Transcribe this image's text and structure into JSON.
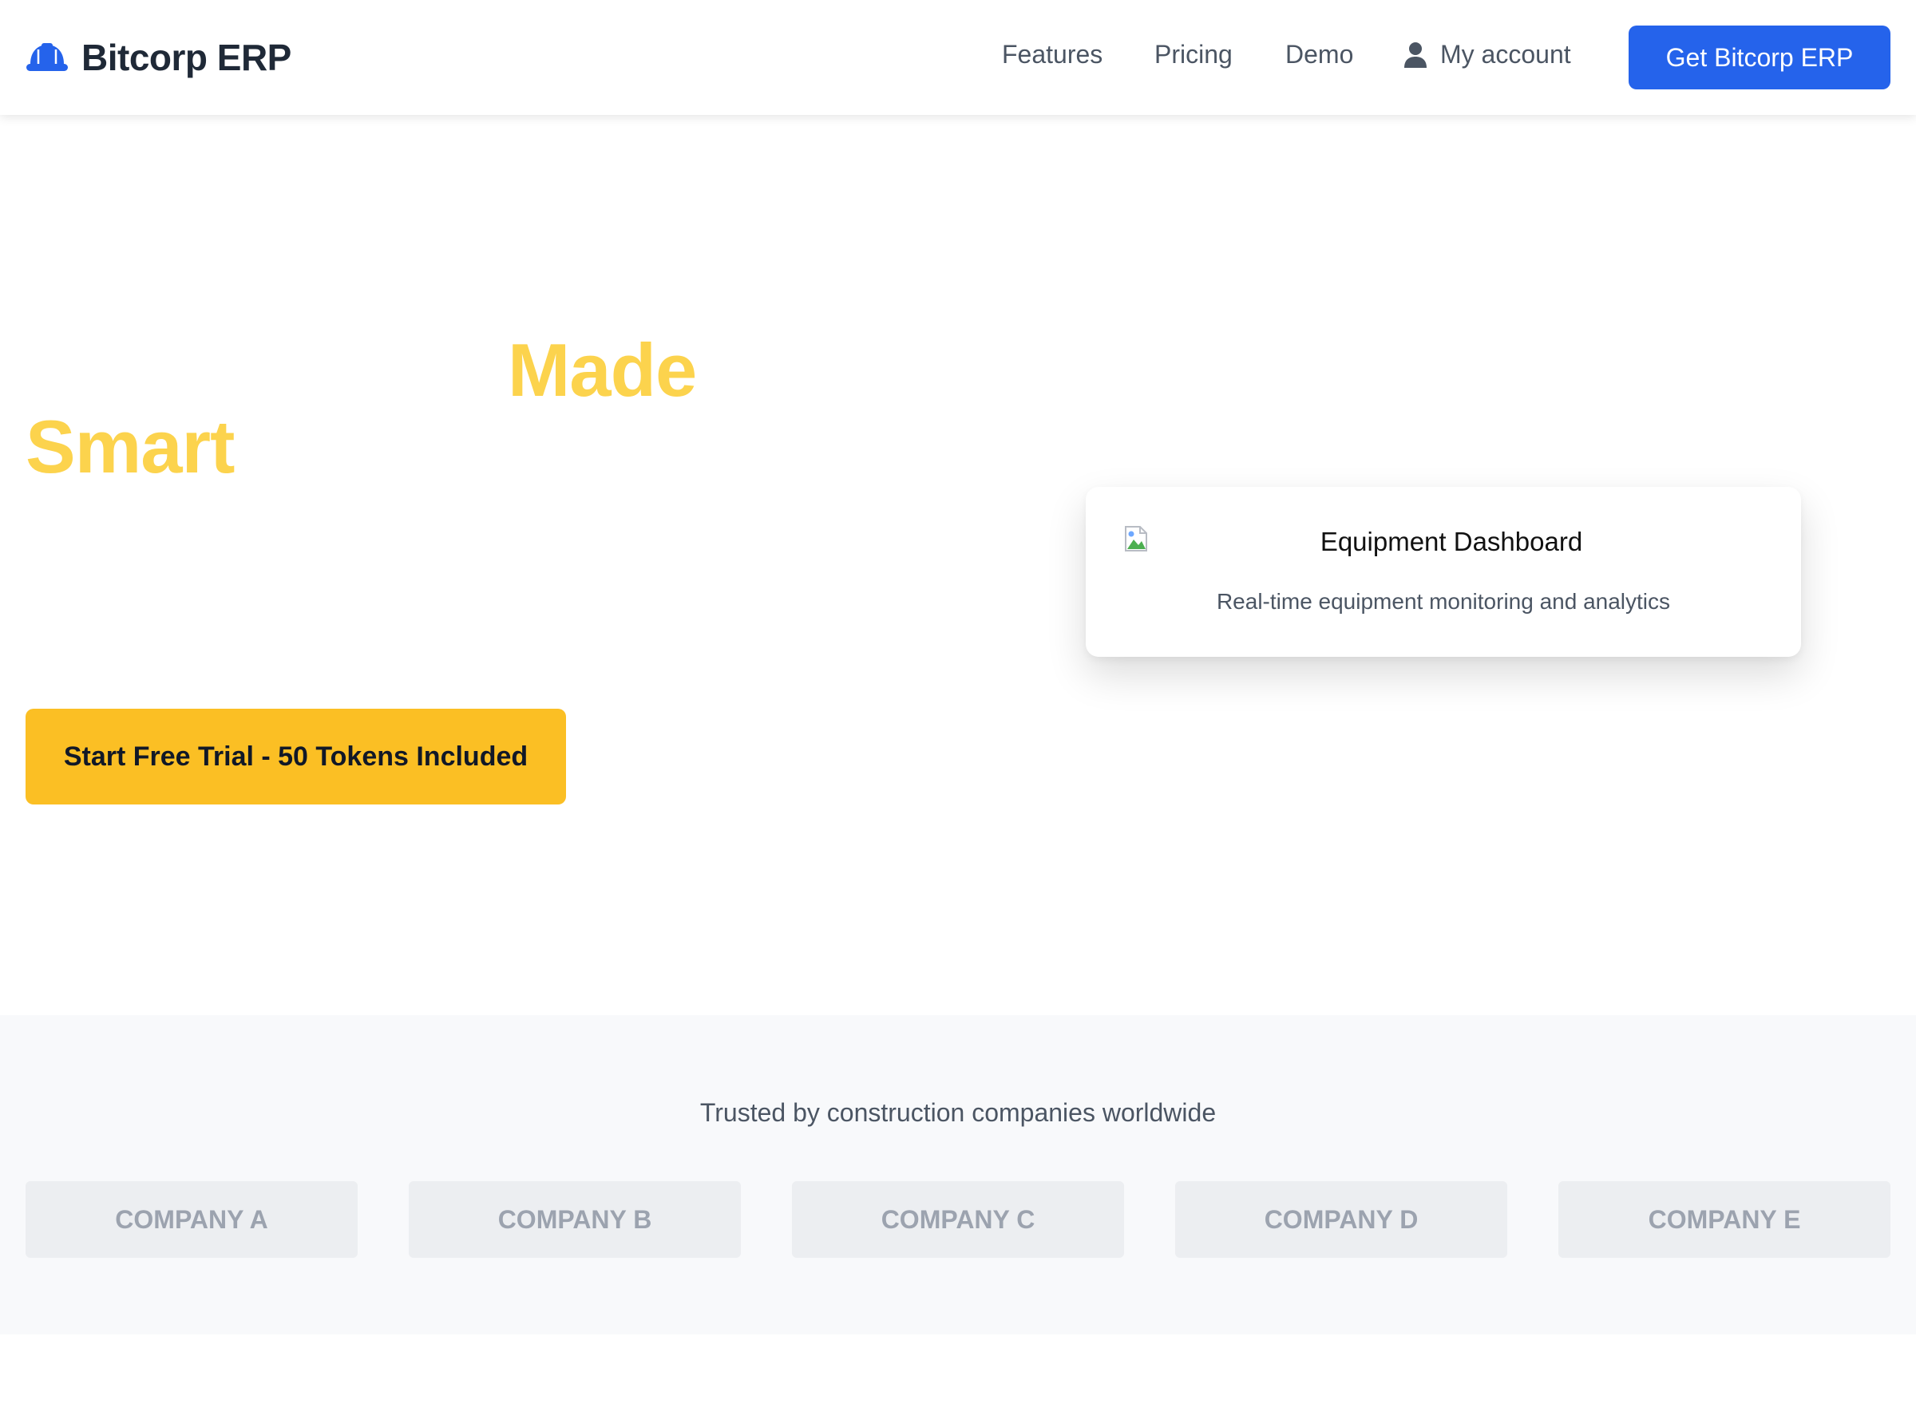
{
  "header": {
    "brand": "Bitcorp ERP",
    "nav": {
      "features": "Features",
      "pricing": "Pricing",
      "demo": "Demo",
      "account": "My account"
    },
    "cta_label": "Get Bitcorp ERP"
  },
  "hero": {
    "word_made": "Made",
    "word_smart": "Smart",
    "trial_button": "Start Free Trial - 50 Tokens Included",
    "card": {
      "title": "Equipment Dashboard",
      "subtitle": "Real-time equipment monitoring and analytics"
    }
  },
  "trusted": {
    "heading": "Trusted by construction companies worldwide",
    "companies": [
      "COMPANY A",
      "COMPANY B",
      "COMPANY C",
      "COMPANY D",
      "COMPANY E"
    ]
  },
  "colors": {
    "brand_blue": "#2563eb",
    "accent_yellow": "#fbbf24",
    "headline_yellow": "#fcd34d"
  },
  "icons": {
    "logo": "hard-hat-icon",
    "account": "user-icon",
    "dashboard_image": "broken-image-icon"
  }
}
